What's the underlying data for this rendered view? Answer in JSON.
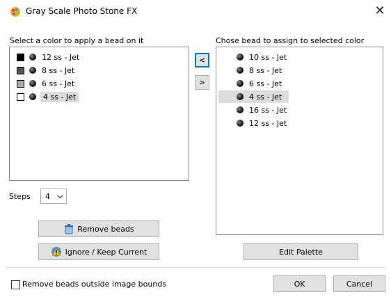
{
  "window": {
    "title": "Gray Scale Photo Stone FX",
    "close_glyph": "✕",
    "icon": "app-palette-icon"
  },
  "left_panel": {
    "label": "Select a color to apply a bead on it",
    "items": [
      {
        "swatch": "#000000",
        "label": "12 ss - Jet"
      },
      {
        "swatch": "#555555",
        "label": "8 ss - Jet"
      },
      {
        "swatch": "#aaaaaa",
        "label": "6 ss - Jet"
      },
      {
        "swatch": "#ffffff",
        "label": "4 ss - Jet",
        "selected": true
      }
    ]
  },
  "steps": {
    "label": "Steps",
    "value": "4"
  },
  "move_buttons": {
    "assign_label": "<",
    "unassign_label": ">"
  },
  "right_panel": {
    "label": "Chose bead to assign to selected color",
    "items": [
      {
        "label": "10 ss - Jet"
      },
      {
        "label": "8 ss - Jet"
      },
      {
        "label": "6 ss - Jet"
      },
      {
        "label": "4 ss - Jet",
        "selected": true
      },
      {
        "label": "16 ss - Jet"
      },
      {
        "label": "12 ss - Jet"
      }
    ]
  },
  "buttons": {
    "remove_beads": "Remove beads",
    "ignore_keep": "Ignore / Keep Current",
    "edit_palette": "Edit Palette",
    "ok": "OK",
    "cancel": "Cancel"
  },
  "footer": {
    "remove_outside_label": "Remove beads outside image bounds",
    "remove_outside_checked": false
  },
  "colors": {
    "focus_blue": "#0078d7",
    "button_face": "#e1e1e1",
    "selection": "#dcdcdc"
  }
}
